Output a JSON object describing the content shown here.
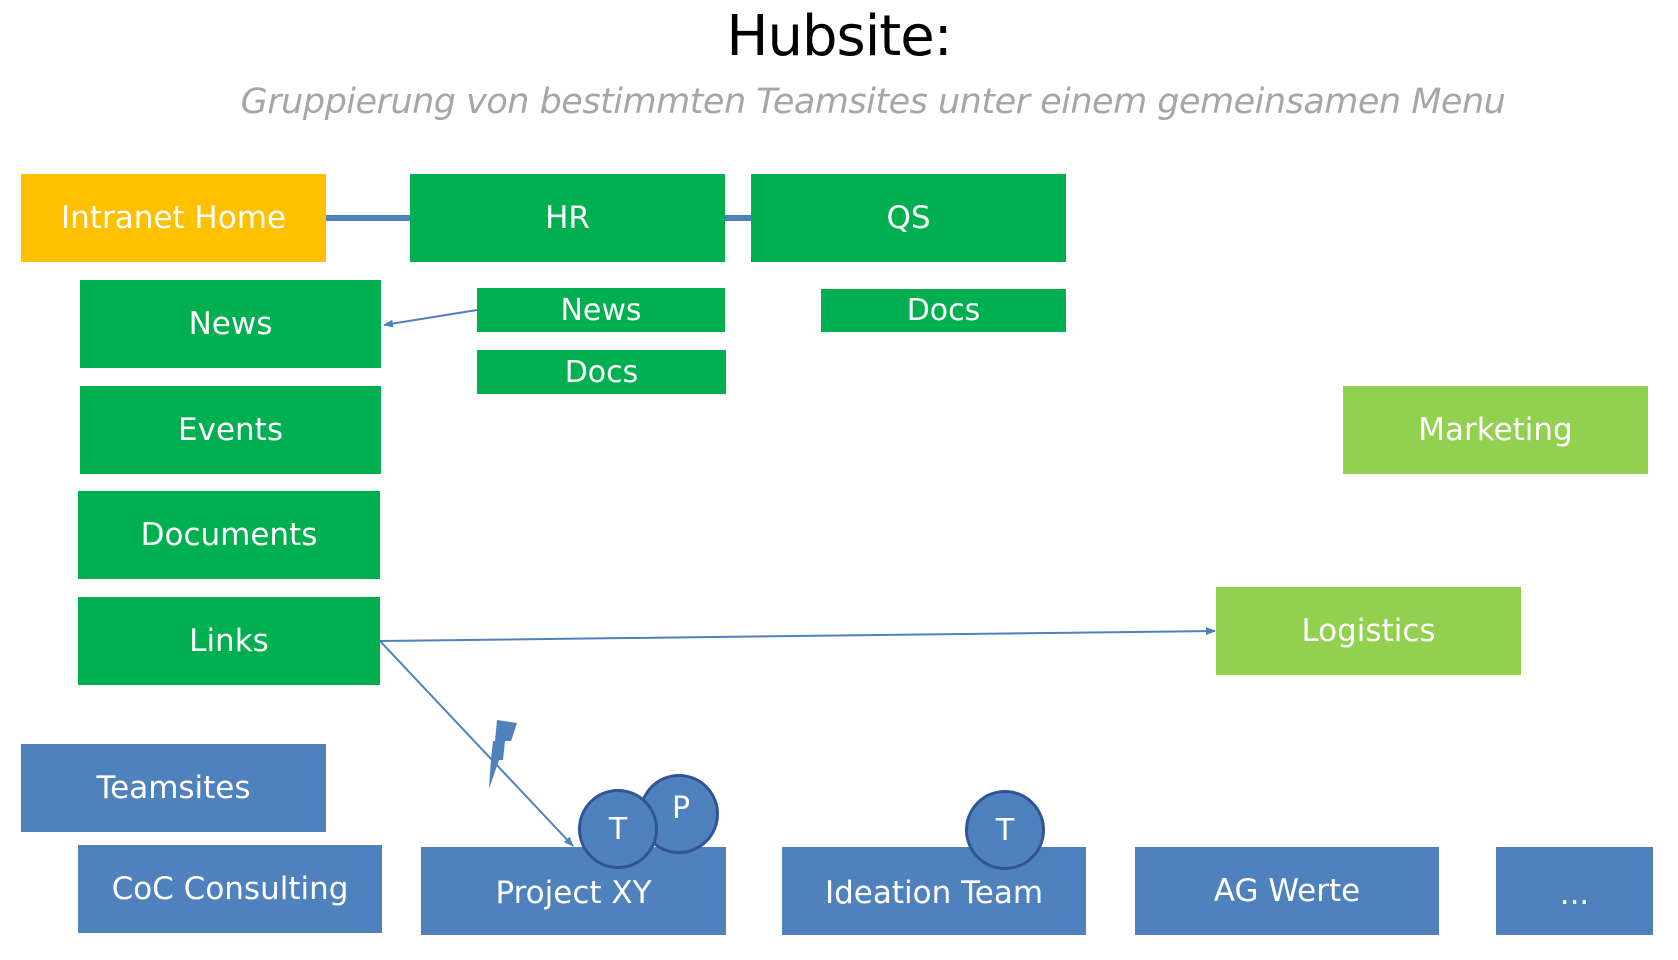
{
  "header": {
    "title": "Hubsite:",
    "subtitle": "Gruppierung von bestimmten Teamsites unter einem gemeinsamen Menu"
  },
  "colors": {
    "hub": "#ffc000",
    "site_green": "#00b050",
    "site_lime": "#92d050",
    "teamsite_blue": "#4f81bd",
    "connector": "#4f81bd",
    "circle_border": "#2f5597"
  },
  "hub": {
    "label": "Intranet Home"
  },
  "hub_sites": [
    {
      "label": "HR",
      "children": [
        "News",
        "Docs"
      ]
    },
    {
      "label": "QS",
      "children": [
        "Docs"
      ]
    }
  ],
  "menu": {
    "items": [
      "News",
      "Events",
      "Documents",
      "Links"
    ]
  },
  "other_sites": [
    "Marketing",
    "Logistics"
  ],
  "teamsites": {
    "label": "Teamsites",
    "items": [
      "CoC Consulting",
      "Project XY",
      "Ideation Team",
      "AG Werte",
      "..."
    ]
  },
  "badges": {
    "project_xy": [
      "T",
      "P"
    ],
    "ideation_team": [
      "T"
    ]
  },
  "connections": [
    {
      "from": "HR / News",
      "to": "News",
      "type": "arrow"
    },
    {
      "from": "Links",
      "to": "Logistics",
      "type": "arrow"
    },
    {
      "from": "Links",
      "to": "Project XY",
      "type": "arrow",
      "annotation": "lightning-bolt"
    },
    {
      "from": "Intranet Home",
      "to": "HR",
      "type": "line"
    },
    {
      "from": "HR",
      "to": "QS",
      "type": "line"
    }
  ]
}
